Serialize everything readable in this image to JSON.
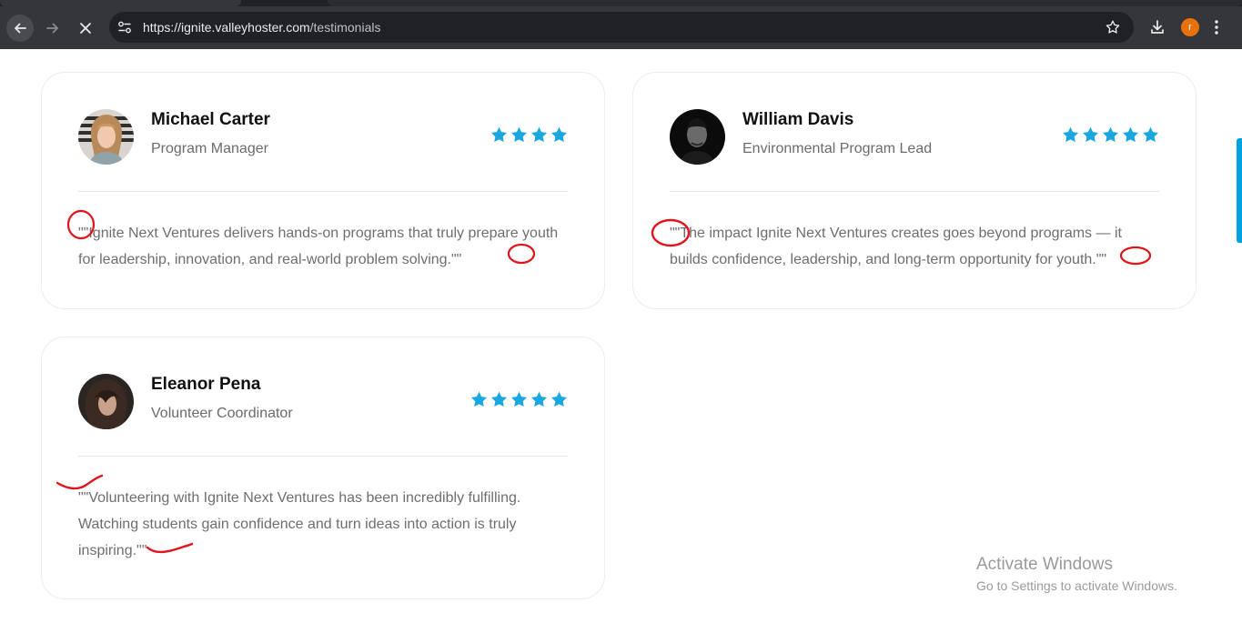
{
  "browser": {
    "url_host": "https://ignite.valleyhoster.com",
    "url_path": "/testimonials",
    "profile_initial": "r"
  },
  "testimonials": [
    {
      "name": "Michael Carter",
      "role": "Program Manager",
      "stars": 4,
      "quote": "\"\"Ignite Next Ventures delivers hands-on programs that truly prepare youth for leadership, innovation, and real-world problem solving.\"\""
    },
    {
      "name": "William Davis",
      "role": "Environmental Program Lead",
      "stars": 5,
      "quote": "\"\"The impact Ignite Next Ventures creates goes beyond programs — it builds confidence, leadership, and long-term opportunity for youth.\"\""
    },
    {
      "name": "Eleanor Pena",
      "role": "Volunteer Coordinator",
      "stars": 5,
      "quote": "\"\"Volunteering with Ignite Next Ventures has been incredibly fulfilling. Watching students gain confidence and turn ideas into action is truly inspiring.\"\""
    }
  ],
  "watermark": {
    "title": "Activate Windows",
    "subtitle": "Go to Settings to activate Windows."
  },
  "colors": {
    "star": "#1aa7e0",
    "annotation": "#e0141c",
    "chrome": "#35363a",
    "omnibox": "#202124"
  }
}
